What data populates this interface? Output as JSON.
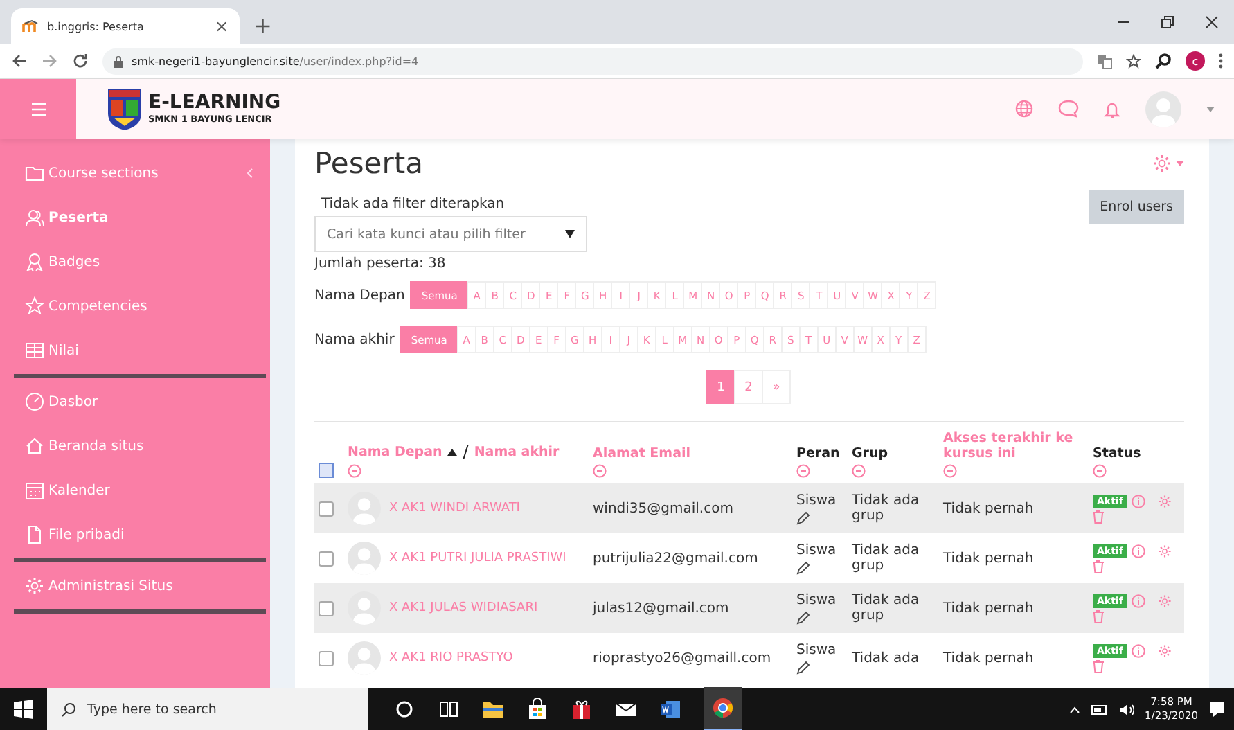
{
  "browser": {
    "tab_title": "b.inggris: Peserta",
    "tab_close": "×",
    "new_tab": "+",
    "url_host": "smk-negeri1-bayunglencir.site",
    "url_path": "/user/index.php?id=4",
    "profile_initial": "c"
  },
  "header": {
    "title": "E-LEARNING",
    "subtitle": "SMKN 1 BAYUNG LENCIR"
  },
  "sidebar": {
    "groups": [
      [
        {
          "label": "Course sections",
          "selected": false
        },
        {
          "label": "Peserta",
          "selected": true
        },
        {
          "label": "Badges",
          "selected": false
        },
        {
          "label": "Competencies",
          "selected": false
        },
        {
          "label": "Nilai",
          "selected": false
        }
      ],
      [
        {
          "label": "Dasbor",
          "selected": false
        },
        {
          "label": "Beranda situs",
          "selected": false
        },
        {
          "label": "Kalender",
          "selected": false
        },
        {
          "label": "File pribadi",
          "selected": false
        }
      ],
      [
        {
          "label": "Administrasi Situs",
          "selected": false
        }
      ]
    ]
  },
  "page": {
    "title": "Peserta",
    "filter_note": "Tidak ada filter diterapkan",
    "enrol_button": "Enrol users",
    "search": {
      "placeholder": "Cari kata kunci atau pilih filter"
    },
    "count": "Jumlah peserta: 38",
    "initial_bars": [
      {
        "label": "Nama Depan",
        "options": [
          {
            "label": "Semua",
            "selected": true
          },
          {
            "label": "A",
            "selected": false
          },
          {
            "label": "B",
            "selected": false
          },
          {
            "label": "C",
            "selected": false
          },
          {
            "label": "D",
            "selected": false
          },
          {
            "label": "E",
            "selected": false
          },
          {
            "label": "F",
            "selected": false
          },
          {
            "label": "G",
            "selected": false
          },
          {
            "label": "H",
            "selected": false
          },
          {
            "label": "I",
            "selected": false
          },
          {
            "label": "J",
            "selected": false
          },
          {
            "label": "K",
            "selected": false
          },
          {
            "label": "L",
            "selected": false
          },
          {
            "label": "M",
            "selected": false
          },
          {
            "label": "N",
            "selected": false
          },
          {
            "label": "O",
            "selected": false
          },
          {
            "label": "P",
            "selected": false
          },
          {
            "label": "Q",
            "selected": false
          },
          {
            "label": "R",
            "selected": false
          },
          {
            "label": "S",
            "selected": false
          },
          {
            "label": "T",
            "selected": false
          },
          {
            "label": "U",
            "selected": false
          },
          {
            "label": "V",
            "selected": false
          },
          {
            "label": "W",
            "selected": false
          },
          {
            "label": "X",
            "selected": false
          },
          {
            "label": "Y",
            "selected": false
          },
          {
            "label": "Z",
            "selected": false
          }
        ]
      },
      {
        "label": "Nama akhir",
        "options": [
          {
            "label": "Semua",
            "selected": true
          },
          {
            "label": "A",
            "selected": false
          },
          {
            "label": "B",
            "selected": false
          },
          {
            "label": "C",
            "selected": false
          },
          {
            "label": "D",
            "selected": false
          },
          {
            "label": "E",
            "selected": false
          },
          {
            "label": "F",
            "selected": false
          },
          {
            "label": "G",
            "selected": false
          },
          {
            "label": "H",
            "selected": false
          },
          {
            "label": "I",
            "selected": false
          },
          {
            "label": "J",
            "selected": false
          },
          {
            "label": "K",
            "selected": false
          },
          {
            "label": "L",
            "selected": false
          },
          {
            "label": "M",
            "selected": false
          },
          {
            "label": "N",
            "selected": false
          },
          {
            "label": "O",
            "selected": false
          },
          {
            "label": "P",
            "selected": false
          },
          {
            "label": "Q",
            "selected": false
          },
          {
            "label": "R",
            "selected": false
          },
          {
            "label": "S",
            "selected": false
          },
          {
            "label": "T",
            "selected": false
          },
          {
            "label": "U",
            "selected": false
          },
          {
            "label": "V",
            "selected": false
          },
          {
            "label": "W",
            "selected": false
          },
          {
            "label": "X",
            "selected": false
          },
          {
            "label": "Y",
            "selected": false
          },
          {
            "label": "Z",
            "selected": false
          }
        ]
      }
    ],
    "pagination": [
      {
        "label": "1",
        "selected": true
      },
      {
        "label": "2",
        "selected": false
      },
      {
        "label": "»",
        "selected": false
      }
    ],
    "table": {
      "columns": [
        {
          "kind": "name",
          "first": "Nama Depan",
          "separator": "/",
          "last": "Nama akhir"
        },
        {
          "kind": "link",
          "label": "Alamat Email"
        },
        {
          "kind": "plain",
          "label": "Peran"
        },
        {
          "kind": "plain",
          "label": "Grup"
        },
        {
          "kind": "link",
          "label": "Akses terakhir ke kursus ini"
        },
        {
          "kind": "plain",
          "label": "Status"
        }
      ],
      "select_all": {
        "checked": false
      },
      "rows": [
        {
          "checked": false,
          "name": "X AK1 WINDI ARWATI",
          "email": "windi35@gmail.com",
          "role": "Siswa",
          "group": "Tidak ada grup",
          "last_access": "Tidak pernah",
          "status": "Aktif"
        },
        {
          "checked": false,
          "name": "X AK1 PUTRI JULIA PRASTIWI",
          "email": "putrijulia22@gmail.com",
          "role": "Siswa",
          "group": "Tidak ada grup",
          "last_access": "Tidak pernah",
          "status": "Aktif"
        },
        {
          "checked": false,
          "name": "X AK1 JULAS WIDIASARI",
          "email": "julas12@gmail.com",
          "role": "Siswa",
          "group": "Tidak ada grup",
          "last_access": "Tidak pernah",
          "status": "Aktif"
        },
        {
          "checked": false,
          "name": "X AK1 RIO PRASTYO",
          "email": "rioprastyo26@gmaill.com",
          "role": "Siswa",
          "group": "Tidak ada",
          "last_access": "Tidak pernah",
          "status": "Aktif"
        }
      ]
    }
  },
  "taskbar": {
    "search": {
      "placeholder": "Type here to search"
    },
    "time": "7:58 PM",
    "date": "1/23/2020"
  }
}
